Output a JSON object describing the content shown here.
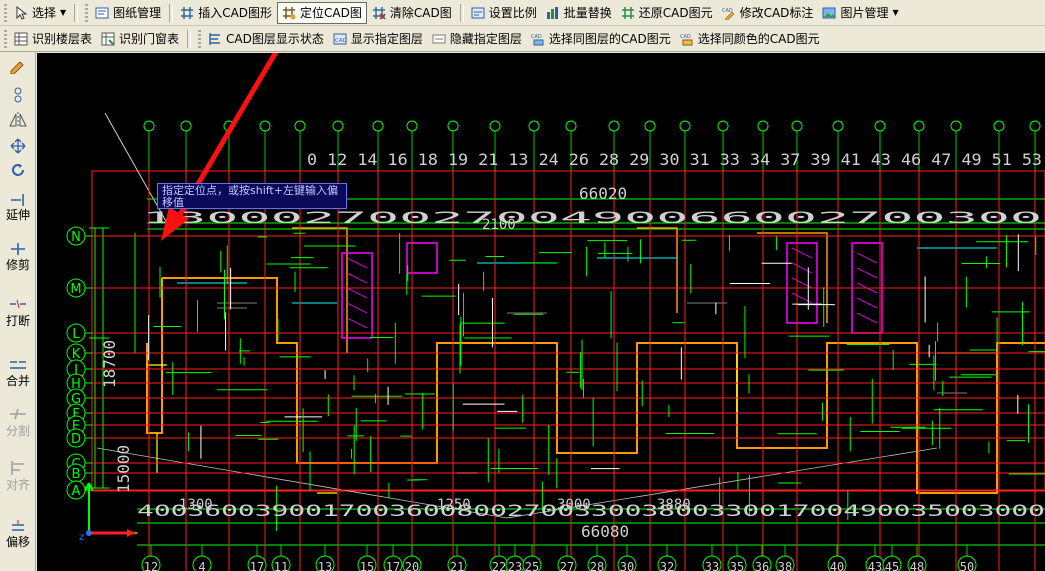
{
  "toolbar1": {
    "items": [
      {
        "label": "选择",
        "icon": "cursor-icon",
        "has_dropdown": true
      },
      {
        "label": "图纸管理",
        "icon": "drawing-manager-icon"
      },
      {
        "label": "插入CAD图形",
        "icon": "insert-cad-icon"
      },
      {
        "label": "定位CAD图",
        "icon": "locate-cad-icon",
        "active": true
      },
      {
        "label": "清除CAD图",
        "icon": "clear-cad-icon"
      },
      {
        "label": "设置比例",
        "icon": "scale-icon"
      },
      {
        "label": "批量替换",
        "icon": "batch-replace-icon"
      },
      {
        "label": "还原CAD图元",
        "icon": "restore-cad-icon"
      },
      {
        "label": "修改CAD标注",
        "icon": "edit-annotation-icon"
      },
      {
        "label": "图片管理",
        "icon": "image-manager-icon",
        "has_dropdown": true
      }
    ]
  },
  "toolbar2": {
    "items": [
      {
        "label": "识别楼层表",
        "icon": "floor-table-icon"
      },
      {
        "label": "识别门窗表",
        "icon": "door-window-table-icon"
      },
      {
        "label": "CAD图层显示状态",
        "icon": "layer-state-icon"
      },
      {
        "label": "显示指定图层",
        "icon": "show-layer-icon"
      },
      {
        "label": "隐藏指定图层",
        "icon": "hide-layer-icon"
      },
      {
        "label": "选择同图层的CAD图元",
        "icon": "select-same-layer-icon"
      },
      {
        "label": "选择同颜色的CAD图元",
        "icon": "select-same-color-icon"
      }
    ]
  },
  "sidebar": {
    "tools": [
      {
        "label": "延伸",
        "icon": "extend-icon"
      },
      {
        "label": "修剪",
        "icon": "trim-icon"
      },
      {
        "label": "打断",
        "icon": "break-icon"
      },
      {
        "label": "合并",
        "icon": "merge-icon"
      },
      {
        "label": "分割",
        "icon": "split-icon",
        "disabled": true
      },
      {
        "label": "对齐",
        "icon": "align-icon",
        "disabled": true
      },
      {
        "label": "偏移",
        "icon": "offset-icon"
      }
    ]
  },
  "canvas": {
    "tooltip": "指定定位点，或按shift+左键输入偏移值",
    "dim_labels": {
      "top_total": "66020",
      "bottom_total": "66080",
      "top_row": "1300027002700490066002700300",
      "bottom_row": "400360039001700360080027003300380033001700490035003000",
      "top_axis_row": "0 12 14 16 18 19 21  13 24 26 28  29  30 31 33 34 37 39 41 43 46 47 49 51 53",
      "left_dim": "18700",
      "left_dim2": "15000"
    },
    "mid_dims": [
      "2100",
      "1300",
      "1250",
      "3000",
      "3880"
    ],
    "row_axes": [
      "N",
      "M",
      "L",
      "K",
      "J",
      "H",
      "G",
      "F",
      "E",
      "D",
      "C",
      "B",
      "A"
    ],
    "bottom_axes": [
      "12",
      "4",
      "17",
      "11",
      "13",
      "15",
      "17",
      "20",
      "21",
      "22",
      "23",
      "25",
      "27",
      "28",
      "30",
      "32",
      "33",
      "35",
      "36",
      "38",
      "40",
      "43",
      "45",
      "48",
      "50"
    ]
  },
  "colors": {
    "canvas_bg": "#000000",
    "grid_red": "#ff2020",
    "wall_green": "#00ff00",
    "accent_orange": "#ff9900",
    "magenta": "#ff00ff",
    "arrow_red": "#ff1010"
  }
}
